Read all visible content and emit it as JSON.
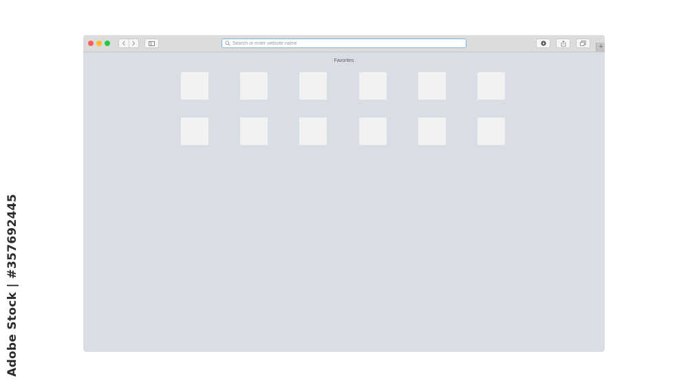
{
  "watermark": {
    "side_text": "Adobe Stock | #357692445"
  },
  "window": {
    "traffic_lights": {
      "close_color": "#fc5f57",
      "minimize_color": "#fdbc2e",
      "maximize_color": "#28c840"
    }
  },
  "toolbar": {
    "back_icon": "chevron-left-icon",
    "forward_icon": "chevron-right-icon",
    "sidebar_icon": "sidebar-icon",
    "download_icon": "download-icon",
    "share_icon": "share-icon",
    "tabs_icon": "tabs-overview-icon",
    "new_tab_label": "+"
  },
  "address_bar": {
    "placeholder": "Search or enter website name",
    "value": "",
    "focus_color": "#7eb7e3"
  },
  "favorites": {
    "title": "Favorites",
    "tiles": [
      {},
      {},
      {},
      {},
      {},
      {},
      {},
      {},
      {},
      {},
      {},
      {}
    ]
  },
  "colors": {
    "content_background": "#d9dee6",
    "tile_background": "#f2f2f2"
  }
}
